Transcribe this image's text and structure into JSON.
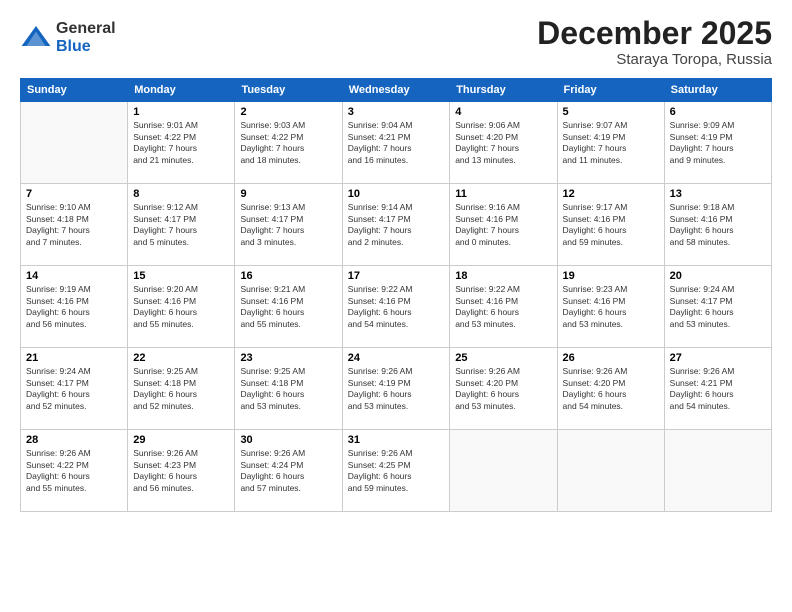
{
  "logo": {
    "general": "General",
    "blue": "Blue"
  },
  "title": "December 2025",
  "subtitle": "Staraya Toropa, Russia",
  "days": [
    "Sunday",
    "Monday",
    "Tuesday",
    "Wednesday",
    "Thursday",
    "Friday",
    "Saturday"
  ],
  "weeks": [
    [
      {
        "date": "",
        "info": ""
      },
      {
        "date": "1",
        "info": "Sunrise: 9:01 AM\nSunset: 4:22 PM\nDaylight: 7 hours\nand 21 minutes."
      },
      {
        "date": "2",
        "info": "Sunrise: 9:03 AM\nSunset: 4:22 PM\nDaylight: 7 hours\nand 18 minutes."
      },
      {
        "date": "3",
        "info": "Sunrise: 9:04 AM\nSunset: 4:21 PM\nDaylight: 7 hours\nand 16 minutes."
      },
      {
        "date": "4",
        "info": "Sunrise: 9:06 AM\nSunset: 4:20 PM\nDaylight: 7 hours\nand 13 minutes."
      },
      {
        "date": "5",
        "info": "Sunrise: 9:07 AM\nSunset: 4:19 PM\nDaylight: 7 hours\nand 11 minutes."
      },
      {
        "date": "6",
        "info": "Sunrise: 9:09 AM\nSunset: 4:19 PM\nDaylight: 7 hours\nand 9 minutes."
      }
    ],
    [
      {
        "date": "7",
        "info": "Sunrise: 9:10 AM\nSunset: 4:18 PM\nDaylight: 7 hours\nand 7 minutes."
      },
      {
        "date": "8",
        "info": "Sunrise: 9:12 AM\nSunset: 4:17 PM\nDaylight: 7 hours\nand 5 minutes."
      },
      {
        "date": "9",
        "info": "Sunrise: 9:13 AM\nSunset: 4:17 PM\nDaylight: 7 hours\nand 3 minutes."
      },
      {
        "date": "10",
        "info": "Sunrise: 9:14 AM\nSunset: 4:17 PM\nDaylight: 7 hours\nand 2 minutes."
      },
      {
        "date": "11",
        "info": "Sunrise: 9:16 AM\nSunset: 4:16 PM\nDaylight: 7 hours\nand 0 minutes."
      },
      {
        "date": "12",
        "info": "Sunrise: 9:17 AM\nSunset: 4:16 PM\nDaylight: 6 hours\nand 59 minutes."
      },
      {
        "date": "13",
        "info": "Sunrise: 9:18 AM\nSunset: 4:16 PM\nDaylight: 6 hours\nand 58 minutes."
      }
    ],
    [
      {
        "date": "14",
        "info": "Sunrise: 9:19 AM\nSunset: 4:16 PM\nDaylight: 6 hours\nand 56 minutes."
      },
      {
        "date": "15",
        "info": "Sunrise: 9:20 AM\nSunset: 4:16 PM\nDaylight: 6 hours\nand 55 minutes."
      },
      {
        "date": "16",
        "info": "Sunrise: 9:21 AM\nSunset: 4:16 PM\nDaylight: 6 hours\nand 55 minutes."
      },
      {
        "date": "17",
        "info": "Sunrise: 9:22 AM\nSunset: 4:16 PM\nDaylight: 6 hours\nand 54 minutes."
      },
      {
        "date": "18",
        "info": "Sunrise: 9:22 AM\nSunset: 4:16 PM\nDaylight: 6 hours\nand 53 minutes."
      },
      {
        "date": "19",
        "info": "Sunrise: 9:23 AM\nSunset: 4:16 PM\nDaylight: 6 hours\nand 53 minutes."
      },
      {
        "date": "20",
        "info": "Sunrise: 9:24 AM\nSunset: 4:17 PM\nDaylight: 6 hours\nand 53 minutes."
      }
    ],
    [
      {
        "date": "21",
        "info": "Sunrise: 9:24 AM\nSunset: 4:17 PM\nDaylight: 6 hours\nand 52 minutes."
      },
      {
        "date": "22",
        "info": "Sunrise: 9:25 AM\nSunset: 4:18 PM\nDaylight: 6 hours\nand 52 minutes."
      },
      {
        "date": "23",
        "info": "Sunrise: 9:25 AM\nSunset: 4:18 PM\nDaylight: 6 hours\nand 53 minutes."
      },
      {
        "date": "24",
        "info": "Sunrise: 9:26 AM\nSunset: 4:19 PM\nDaylight: 6 hours\nand 53 minutes."
      },
      {
        "date": "25",
        "info": "Sunrise: 9:26 AM\nSunset: 4:20 PM\nDaylight: 6 hours\nand 53 minutes."
      },
      {
        "date": "26",
        "info": "Sunrise: 9:26 AM\nSunset: 4:20 PM\nDaylight: 6 hours\nand 54 minutes."
      },
      {
        "date": "27",
        "info": "Sunrise: 9:26 AM\nSunset: 4:21 PM\nDaylight: 6 hours\nand 54 minutes."
      }
    ],
    [
      {
        "date": "28",
        "info": "Sunrise: 9:26 AM\nSunset: 4:22 PM\nDaylight: 6 hours\nand 55 minutes."
      },
      {
        "date": "29",
        "info": "Sunrise: 9:26 AM\nSunset: 4:23 PM\nDaylight: 6 hours\nand 56 minutes."
      },
      {
        "date": "30",
        "info": "Sunrise: 9:26 AM\nSunset: 4:24 PM\nDaylight: 6 hours\nand 57 minutes."
      },
      {
        "date": "31",
        "info": "Sunrise: 9:26 AM\nSunset: 4:25 PM\nDaylight: 6 hours\nand 59 minutes."
      },
      {
        "date": "",
        "info": ""
      },
      {
        "date": "",
        "info": ""
      },
      {
        "date": "",
        "info": ""
      }
    ]
  ]
}
